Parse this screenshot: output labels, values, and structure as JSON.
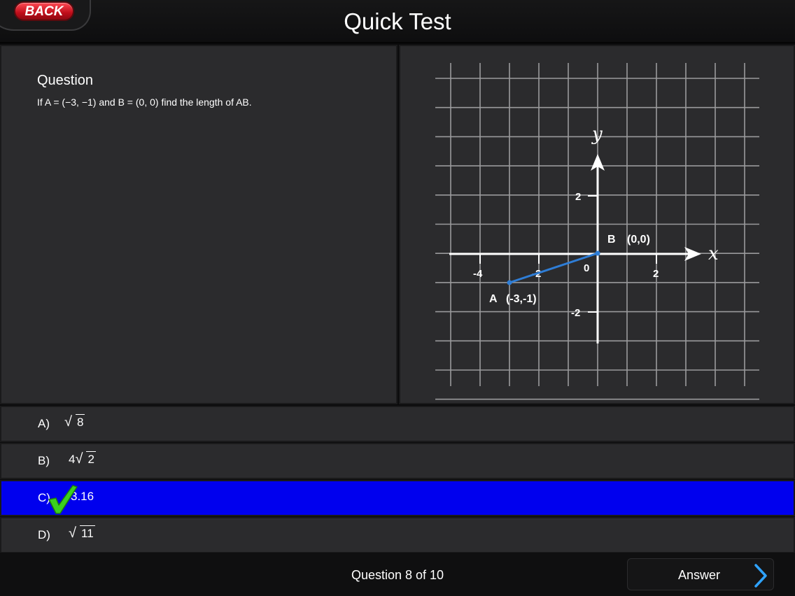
{
  "header": {
    "back_label": "BACK",
    "title": "Quick Test"
  },
  "question": {
    "heading": "Question",
    "text": "If A = (−3, −1) and B = (0, 0) find the length of AB."
  },
  "graph": {
    "x_axis_label": "x",
    "y_axis_label": "y",
    "origin_label": "0",
    "x_ticks": [
      "-4",
      "-2",
      "2"
    ],
    "y_ticks": [
      "2",
      "-2"
    ],
    "point_a_label": "A",
    "point_a_coords": "(-3,-1)",
    "point_b_label": "B",
    "point_b_coords": "(0,0)",
    "line_color": "#2e7dd6",
    "grid_color": "#9a9a9c"
  },
  "options": [
    {
      "letter": "A)",
      "radicand": "8",
      "coef": ""
    },
    {
      "letter": "B)",
      "radicand": "2",
      "coef": "4"
    },
    {
      "letter": "C)",
      "value": "3.16",
      "selected": true
    },
    {
      "letter": "D)",
      "radicand": "11",
      "coef": ""
    }
  ],
  "colors": {
    "selected_option": "#0000ee",
    "correct_check": "#3bd11d",
    "back_button": "#d4101e"
  },
  "footer": {
    "progress": "Question 8 of 10",
    "answer_label": "Answer"
  }
}
